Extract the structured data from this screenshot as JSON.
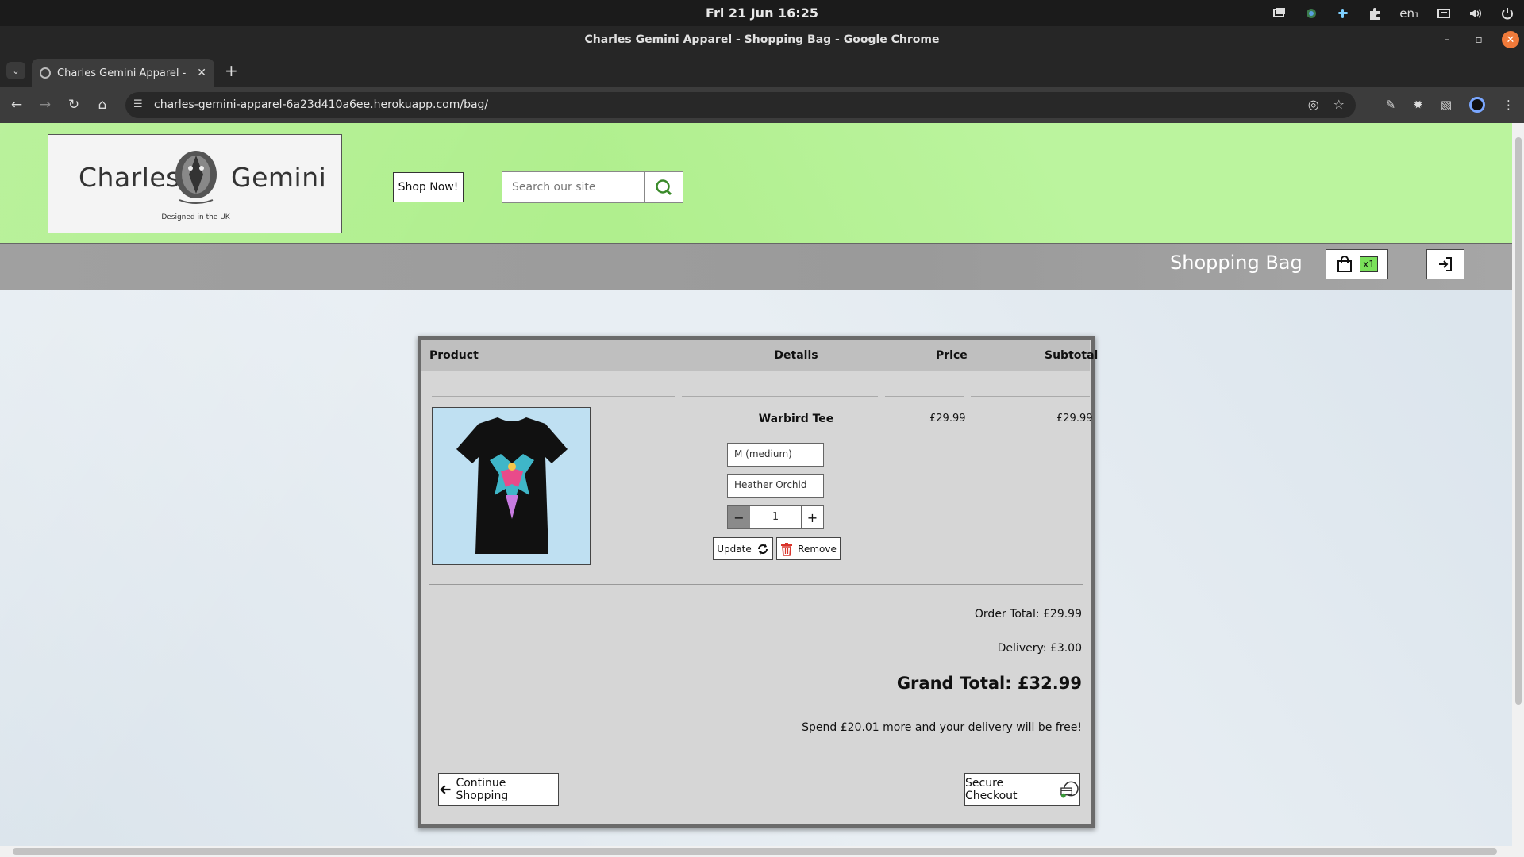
{
  "os": {
    "clock": "Fri 21 Jun  16:25",
    "lang": "en₁"
  },
  "browser": {
    "window_title": "Charles Gemini Apparel - Shopping Bag - Google Chrome",
    "tab_title": "Charles Gemini Apparel - Shopping Bag",
    "url": "charles-gemini-apparel-6a23d410a6ee.herokuapp.com/bag/"
  },
  "header": {
    "logo_left": "Charles",
    "logo_right": "Gemini",
    "logo_tagline": "Designed in the UK",
    "shop_now": "Shop Now!",
    "search_placeholder": "Search our site"
  },
  "subheader": {
    "title": "Shopping Bag",
    "bag_count": "x1"
  },
  "bag": {
    "columns": {
      "product": "Product",
      "details": "Details",
      "price": "Price",
      "subtotal": "Subtotal"
    },
    "item": {
      "name": "Warbird Tee",
      "price": "£29.99",
      "subtotal": "£29.99",
      "size": "M (medium)",
      "colour": "Heather Orchid",
      "quantity": "1",
      "update_label": "Update",
      "remove_label": "Remove"
    },
    "order_total": "Order Total: £29.99",
    "delivery": "Delivery: £3.00",
    "grand_total": "Grand Total: £32.99",
    "free_delivery_msg": "Spend £20.01 more and your delivery will be free!",
    "continue_label": "Continue Shopping",
    "checkout_label": "Secure Checkout"
  },
  "colors": {
    "header_green": "#b9f29c",
    "bag_badge_green": "#7ae05a",
    "remove_red": "#d9342b"
  }
}
